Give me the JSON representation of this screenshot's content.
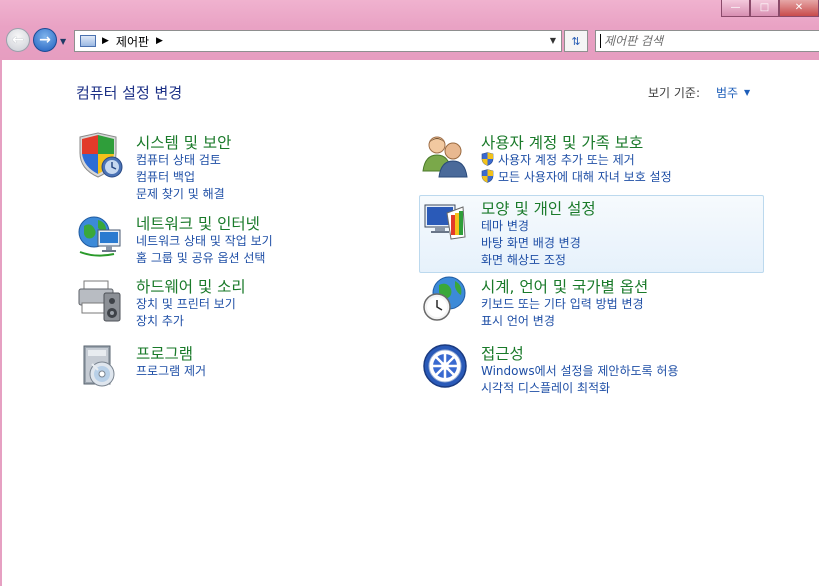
{
  "window": {
    "minimize_glyph": "—",
    "maximize_glyph": "□",
    "close_glyph": "✕"
  },
  "nav": {
    "back_icon": "back-arrow-icon",
    "forward_icon": "forward-arrow-icon"
  },
  "address": {
    "path": "제어판"
  },
  "search": {
    "placeholder": "제어판 검색"
  },
  "header": {
    "title": "컴퓨터 설정 변경",
    "view_by_label": "보기 기준:",
    "view_by_value": "범주"
  },
  "categories": [
    {
      "title": "시스템 및 보안",
      "icon": "system-security-shield-icon",
      "links": [
        "컴퓨터 상태 검토",
        "컴퓨터 백업",
        "문제 찾기 및 해결"
      ]
    },
    {
      "title": "네트워크 및 인터넷",
      "icon": "network-globe-icon",
      "links": [
        "네트워크 상태 및 작업 보기",
        "홈 그룹 및 공유 옵션 선택"
      ]
    },
    {
      "title": "하드웨어 및 소리",
      "icon": "printer-speaker-icon",
      "links": [
        "장치 및 프린터 보기",
        "장치 추가"
      ]
    },
    {
      "title": "프로그램",
      "icon": "programs-box-icon",
      "links": [
        "프로그램 제거"
      ]
    },
    {
      "title": "사용자 계정 및 가족 보호",
      "icon": "users-icon",
      "links": [
        "사용자 계정 추가 또는 제거",
        "모든 사용자에 대해 자녀 보호 설정"
      ]
    },
    {
      "title": "모양 및 개인 설정",
      "icon": "appearance-monitor-icon",
      "links": [
        "테마 변경",
        "바탕 화면 배경 변경",
        "화면 해상도 조정"
      ]
    },
    {
      "title": "시계, 언어 및 국가별 옵션",
      "icon": "clock-globe-icon",
      "links": [
        "키보드 또는 기타 입력 방법 변경",
        "표시 언어 변경"
      ]
    },
    {
      "title": "접근성",
      "icon": "ease-of-access-icon",
      "links": [
        "Windows에서 설정을 제안하도록 허용",
        "시각적 디스플레이 최적화"
      ]
    }
  ]
}
